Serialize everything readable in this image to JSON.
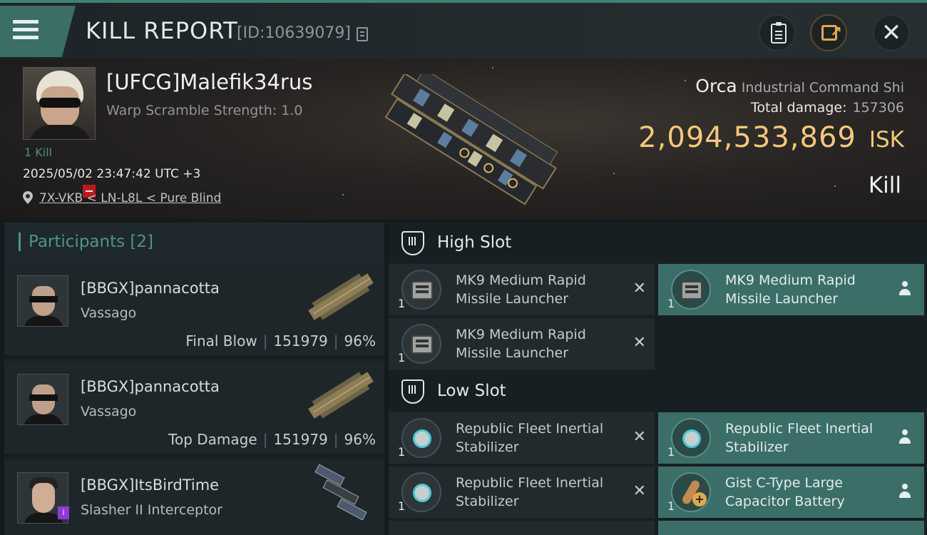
{
  "header": {
    "title": "KILL REPORT",
    "report_id": "[ID:10639079]",
    "icons": {
      "menu": "menu-icon",
      "copy": "copy-icon",
      "clipboard": "clipboard-icon",
      "share": "share-icon",
      "close": "close-icon"
    }
  },
  "victim": {
    "name": "[UFCG]Malefik34rus",
    "warp_scramble": "Warp Scramble Strength: 1.0",
    "kill_count": "1 Kill",
    "datetime": "2025/05/02 23:47:42 UTC +3",
    "location": "7X-VKB < LN-L8L < Pure Blind",
    "ship_name": "Orca",
    "ship_class": "Industrial Command Shi",
    "total_damage_label": "Total damage:",
    "total_damage": "157306",
    "isk_value": "2,094,533,869",
    "isk_unit": "ISK",
    "result": "Kill"
  },
  "participants": {
    "title": "Participants [2]",
    "rows": [
      {
        "name": "[BBGX]pannacotta",
        "ship": "Vassago",
        "role": "Final Blow",
        "damage": "151979",
        "percent": "96%"
      },
      {
        "name": "[BBGX]pannacotta",
        "ship": "Vassago",
        "role": "Top Damage",
        "damage": "151979",
        "percent": "96%"
      },
      {
        "name": "[BBGX]ItsBirdTime",
        "ship": "Slasher II Interceptor",
        "badge": "i"
      }
    ]
  },
  "slots": {
    "high": {
      "title": "High Slot",
      "modules": [
        {
          "qty": "1",
          "name": "MK9 Medium Rapid Missile Launcher",
          "status": "destroyed"
        },
        {
          "qty": "1",
          "name": "MK9 Medium Rapid Missile Launcher",
          "status": "dropped"
        },
        {
          "qty": "1",
          "name": "MK9 Medium Rapid Missile Launcher",
          "status": "destroyed"
        }
      ]
    },
    "low": {
      "title": "Low Slot",
      "modules": [
        {
          "qty": "1",
          "name": "Republic Fleet Inertial Stabilizer",
          "status": "destroyed"
        },
        {
          "qty": "1",
          "name": "Republic Fleet Inertial Stabilizer",
          "status": "dropped"
        },
        {
          "qty": "1",
          "name": "Republic Fleet Inertial Stabilizer",
          "status": "destroyed"
        },
        {
          "qty": "1",
          "name": "Gist C-Type Large Capacitor Battery",
          "status": "dropped"
        }
      ]
    }
  },
  "colors": {
    "accent": "#3f7f77",
    "isk": "#f3c87a",
    "owned_slot": "#3b6e69"
  }
}
